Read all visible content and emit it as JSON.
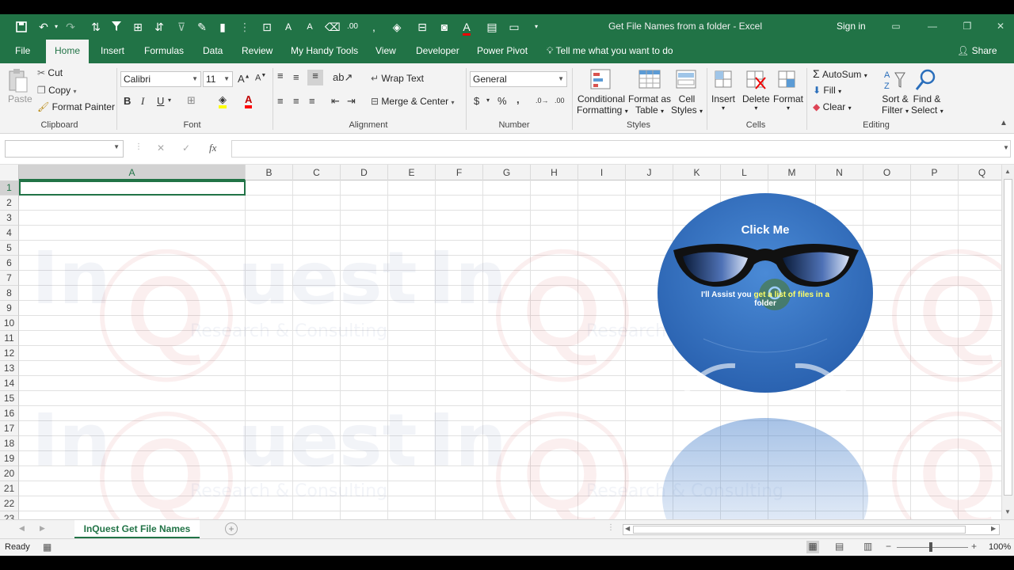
{
  "app": {
    "title": "Get File Names from a folder  -  Excel",
    "signin": "Sign in",
    "share": "Share"
  },
  "tabs": [
    "File",
    "Home",
    "Insert",
    "Formulas",
    "Data",
    "Review",
    "My Handy Tools",
    "View",
    "Developer",
    "Power Pivot"
  ],
  "tellme": "Tell me what you want to do",
  "ribbon": {
    "clipboard": {
      "paste": "Paste",
      "cut": "Cut",
      "copy": "Copy",
      "format_painter": "Format Painter",
      "label": "Clipboard"
    },
    "font": {
      "name": "Calibri",
      "size": "11",
      "bold": "B",
      "italic": "I",
      "underline": "U",
      "label": "Font"
    },
    "alignment": {
      "wrap": "Wrap Text",
      "merge": "Merge & Center",
      "label": "Alignment"
    },
    "number": {
      "format": "General",
      "currency": "$",
      "percent": "%",
      "comma": ",",
      "label": "Number"
    },
    "styles": {
      "conditional1": "Conditional",
      "conditional2": "Formatting",
      "format_as1": "Format as",
      "format_as2": "Table",
      "cell_styles1": "Cell",
      "cell_styles2": "Styles",
      "label": "Styles"
    },
    "cells": {
      "insert": "Insert",
      "delete": "Delete",
      "format": "Format",
      "label": "Cells"
    },
    "editing": {
      "autosum": "AutoSum",
      "fill": "Fill",
      "clear": "Clear",
      "sort1": "Sort &",
      "sort2": "Filter",
      "find1": "Find &",
      "find2": "Select",
      "label": "Editing"
    }
  },
  "formula_bar": {
    "fx": "fx",
    "name_box": "",
    "content": ""
  },
  "columns": [
    "A",
    "B",
    "C",
    "D",
    "E",
    "F",
    "G",
    "H",
    "I",
    "J",
    "K",
    "L",
    "M",
    "N",
    "O",
    "P",
    "Q"
  ],
  "rows": [
    "1",
    "2",
    "3",
    "4",
    "5",
    "6",
    "7",
    "8",
    "9",
    "10",
    "11",
    "12",
    "13",
    "14",
    "15",
    "16",
    "17",
    "18",
    "19",
    "20",
    "21",
    "22",
    "23"
  ],
  "watermark": {
    "brand_in": "In",
    "brand_uest": "uest",
    "tagline": "Research & Consulting"
  },
  "assistant": {
    "click_me": "Click Me",
    "line1_a": "I'll Assist you ",
    "line1_b": "get a list of files in a",
    "line2": "folder"
  },
  "sheet_tab": "InQuest Get File Names",
  "status": {
    "ready": "Ready",
    "zoom": "100%"
  },
  "colors": {
    "excel_green": "#217346",
    "assistant_blue": "#3b78c8"
  }
}
